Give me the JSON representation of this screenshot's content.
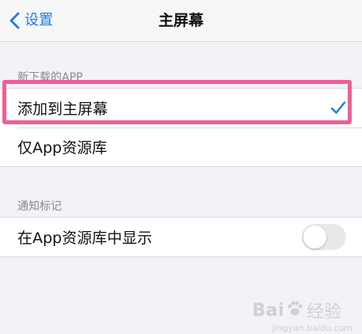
{
  "navbar": {
    "back_label": "设置",
    "title": "主屏幕"
  },
  "new_app_section": {
    "header": "新下载的APP",
    "options": [
      {
        "label": "添加到主屏幕",
        "selected": true
      },
      {
        "label": "仅App资源库",
        "selected": false
      }
    ]
  },
  "badge_section": {
    "header": "通知标记",
    "rows": [
      {
        "label": "在App资源库中显示",
        "toggle_on": false
      }
    ]
  },
  "watermark": {
    "brand_left": "Bai",
    "brand_right": "经验",
    "url": "jingyan.baidu.com"
  },
  "colors": {
    "accent": "#1f7aea",
    "highlight": "#ef5f97",
    "background": "#f2f2f7"
  }
}
